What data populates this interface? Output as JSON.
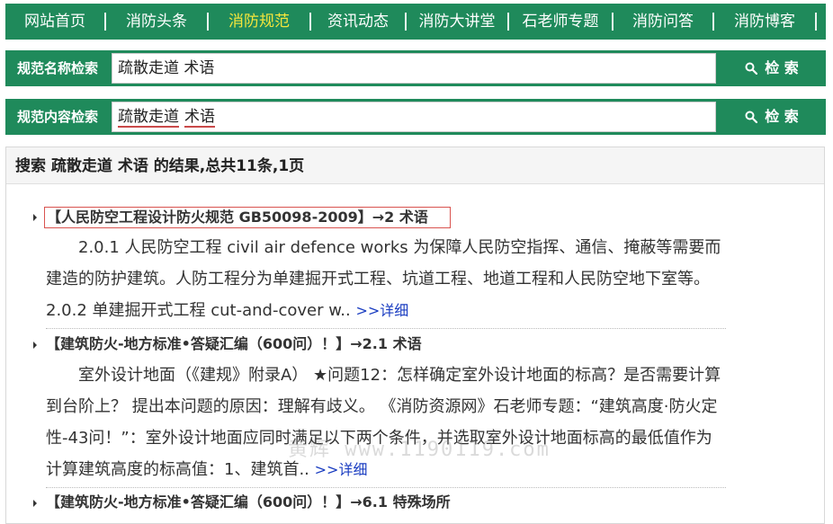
{
  "nav": {
    "items": [
      {
        "label": "网站首页",
        "active": false
      },
      {
        "label": "消防头条",
        "active": false
      },
      {
        "label": "消防规范",
        "active": true
      },
      {
        "label": "资讯动态",
        "active": false
      },
      {
        "label": "消防大讲堂",
        "active": false
      },
      {
        "label": "石老师专题",
        "active": false
      },
      {
        "label": "消防问答",
        "active": false
      },
      {
        "label": "消防博客",
        "active": false
      }
    ]
  },
  "search_name": {
    "label": "规范名称检索",
    "value": "疏散走道 术语",
    "button": "检 索"
  },
  "search_content": {
    "label": "规范内容检索",
    "value_part1": "疏散走道",
    "value_part2": "术语",
    "button": "检 索"
  },
  "results": {
    "header": "搜索 疏散走道 术语 的结果,总共11条,1页",
    "items": [
      {
        "title": "【人民防空工程设计防火规范 GB50098-2009】→2 术语",
        "body": "2.0.1 人民防空工程  civil air defence works     为保障人民防空指挥、通信、掩蔽等需要而建造的防护建筑。人防工程分为单建掘开式工程、坑道工程、地道工程和人民防空地下室等。 2.0.2 单建掘开式工程  cut-and-cover w..",
        "more": ">>详细"
      },
      {
        "title": "【建筑防火-地方标准•答疑汇编（600问）！】→2.1 术语",
        "body": "室外设计地面（《建规》附录A） ★问题12：怎样确定室外设计地面的标高？是否需要计算到台阶上？   提出本问题的原因：理解有歧义。   《消防资源网》石老师专题：“建筑高度·防火定性-43问！”：室外设计地面应同时满足以下两个条件，并选取室外设计地面标高的最低值作为计算建筑高度的标高值：1、建筑首..",
        "more": ">>详细"
      },
      {
        "title": "【建筑防火-地方标准•答疑汇编（600问）！】→6.1 特殊场所",
        "body": "",
        "more": ""
      }
    ]
  },
  "watermark": "黄辉 www.1190119.com"
}
